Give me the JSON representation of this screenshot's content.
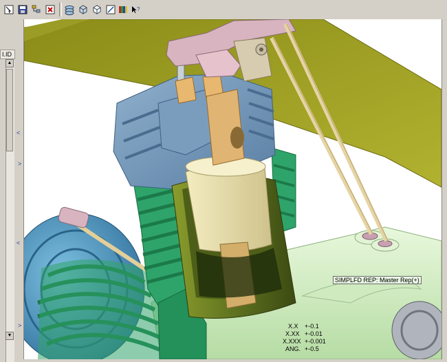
{
  "toolbar": {
    "buttons": [
      {
        "name": "select-icon"
      },
      {
        "name": "save-icon"
      },
      {
        "name": "tree-icon"
      },
      {
        "name": "close-window-icon"
      },
      {
        "name": "layers-icon"
      },
      {
        "name": "shaded-cube-icon"
      },
      {
        "name": "cube-outline-icon"
      },
      {
        "name": "named-view-icon"
      },
      {
        "name": "color-palette-icon"
      },
      {
        "name": "context-help-icon"
      }
    ]
  },
  "model_tree": {
    "header": "I.ID"
  },
  "viewport": {
    "rep_label": "SIMPLFD REP: Master Rep(+)",
    "tolerances": [
      {
        "label": "X.X",
        "value": "+-0.1"
      },
      {
        "label": "X.XX",
        "value": "+-0.01"
      },
      {
        "label": "X.XXX",
        "value": "+-0.001"
      },
      {
        "label": "ANG.",
        "value": "+-0.5"
      }
    ]
  },
  "colors": {
    "frame": "#8a8c18",
    "piston_cylinder": "#5f7320",
    "fins_green": "#2fa46a",
    "head_blue": "#6f95b8",
    "rocker": "#d8b4c0",
    "rods": "#e8d29c",
    "crankcase": "#d6f0c4",
    "flywheel": "#4f9ec8"
  }
}
